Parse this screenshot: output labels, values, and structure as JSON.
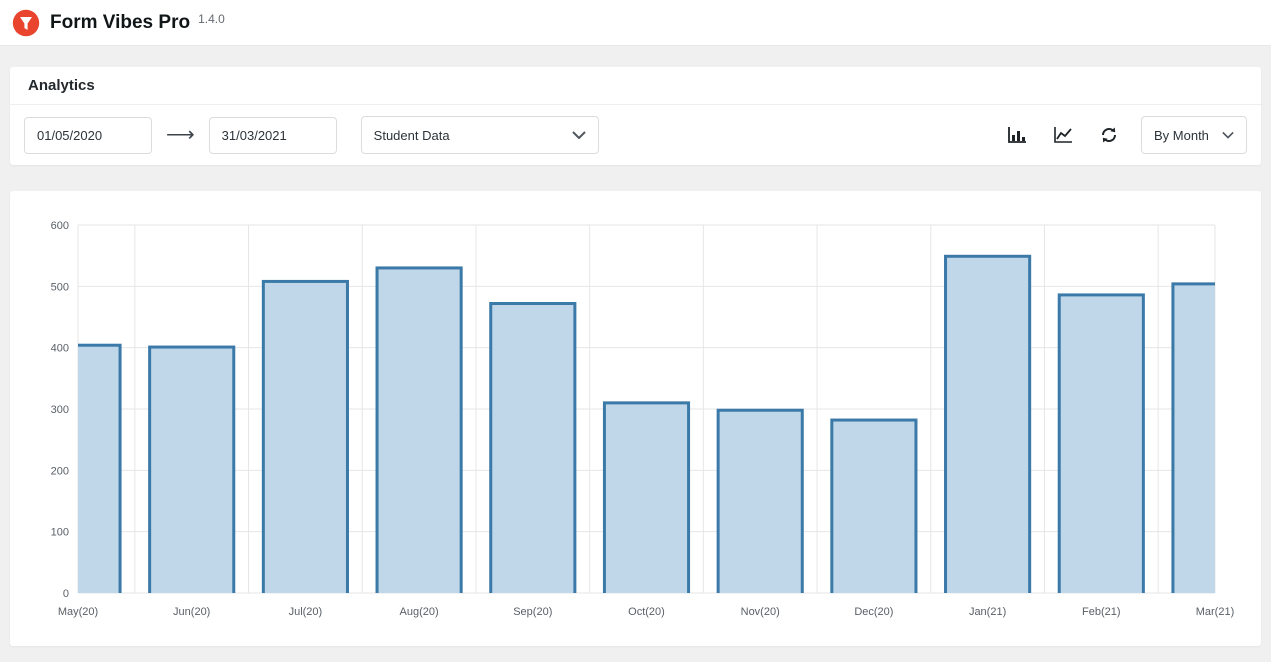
{
  "header": {
    "title": "Form Vibes Pro",
    "version": "1.4.0",
    "logo_icon": "form-vibes-logo",
    "brand_color": "#E8442E"
  },
  "analytics": {
    "title": "Analytics",
    "toolbar": {
      "date_from": "01/05/2020",
      "date_to": "31/03/2021",
      "arrow_icon": "long-right-arrow",
      "source_select": {
        "value": "Student Data",
        "chevron_icon": "chevron-down"
      },
      "view_icons": [
        "bar-chart",
        "line-chart"
      ],
      "refresh_icon": "refresh",
      "group_by_select": {
        "value": "By Month",
        "chevron_icon": "chevron-down"
      }
    }
  },
  "chart_data": {
    "type": "bar",
    "title": "",
    "xlabel": "",
    "ylabel": "",
    "categories": [
      "May(20)",
      "Jun(20)",
      "Jul(20)",
      "Aug(20)",
      "Sep(20)",
      "Oct(20)",
      "Nov(20)",
      "Dec(20)",
      "Jan(21)",
      "Feb(21)",
      "Mar(21)"
    ],
    "values": [
      404,
      401,
      508,
      530,
      472,
      310,
      298,
      282,
      549,
      486,
      504
    ],
    "ylim": [
      0,
      600
    ],
    "ytick_step": 100,
    "grid": true,
    "legend": "none",
    "bar_fill": "#BFD7E8",
    "bar_border": "#3B79A8",
    "grid_color": "#E6E6E6",
    "axis_label_color": "#5A6067"
  }
}
